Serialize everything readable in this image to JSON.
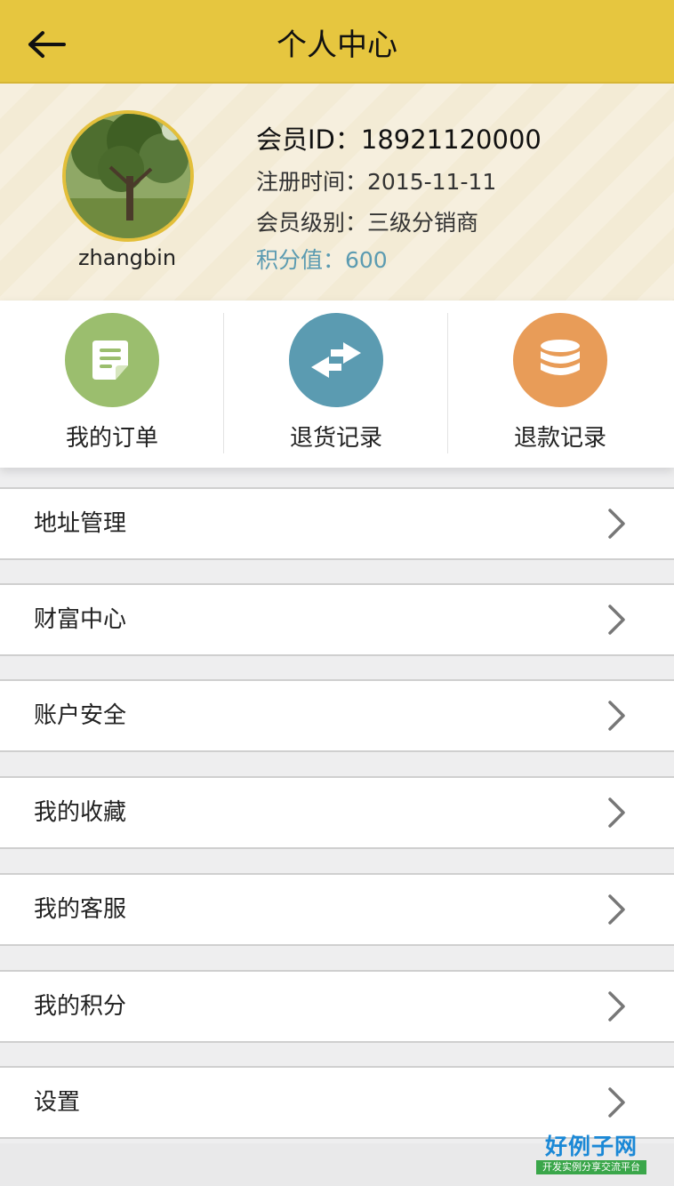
{
  "header": {
    "title": "个人中心",
    "back_icon": "arrow-left-icon",
    "color": "#e6c63f"
  },
  "profile": {
    "username": "zhangbin",
    "member_id": "会员ID：18921120000",
    "reg_time": "注册时间：2015-11-11",
    "level": "会员级别：三级分销商",
    "points": "积分值：600",
    "points_color": "#5b9bb1"
  },
  "actions": [
    {
      "label": "我的订单",
      "icon": "document-icon",
      "color": "#9bbe6e"
    },
    {
      "label": "退货记录",
      "icon": "exchange-arrows-icon",
      "color": "#5b9bb1"
    },
    {
      "label": "退款记录",
      "icon": "database-stack-icon",
      "color": "#e89c58"
    }
  ],
  "menu": {
    "items": [
      {
        "label": "地址管理"
      },
      {
        "label": "财富中心"
      },
      {
        "label": "账户安全"
      },
      {
        "label": "我的收藏"
      },
      {
        "label": "我的客服"
      },
      {
        "label": "我的积分"
      },
      {
        "label": "设置"
      }
    ]
  },
  "brand": {
    "main": "好例子网",
    "sub": "开发实例分享交流平台"
  }
}
